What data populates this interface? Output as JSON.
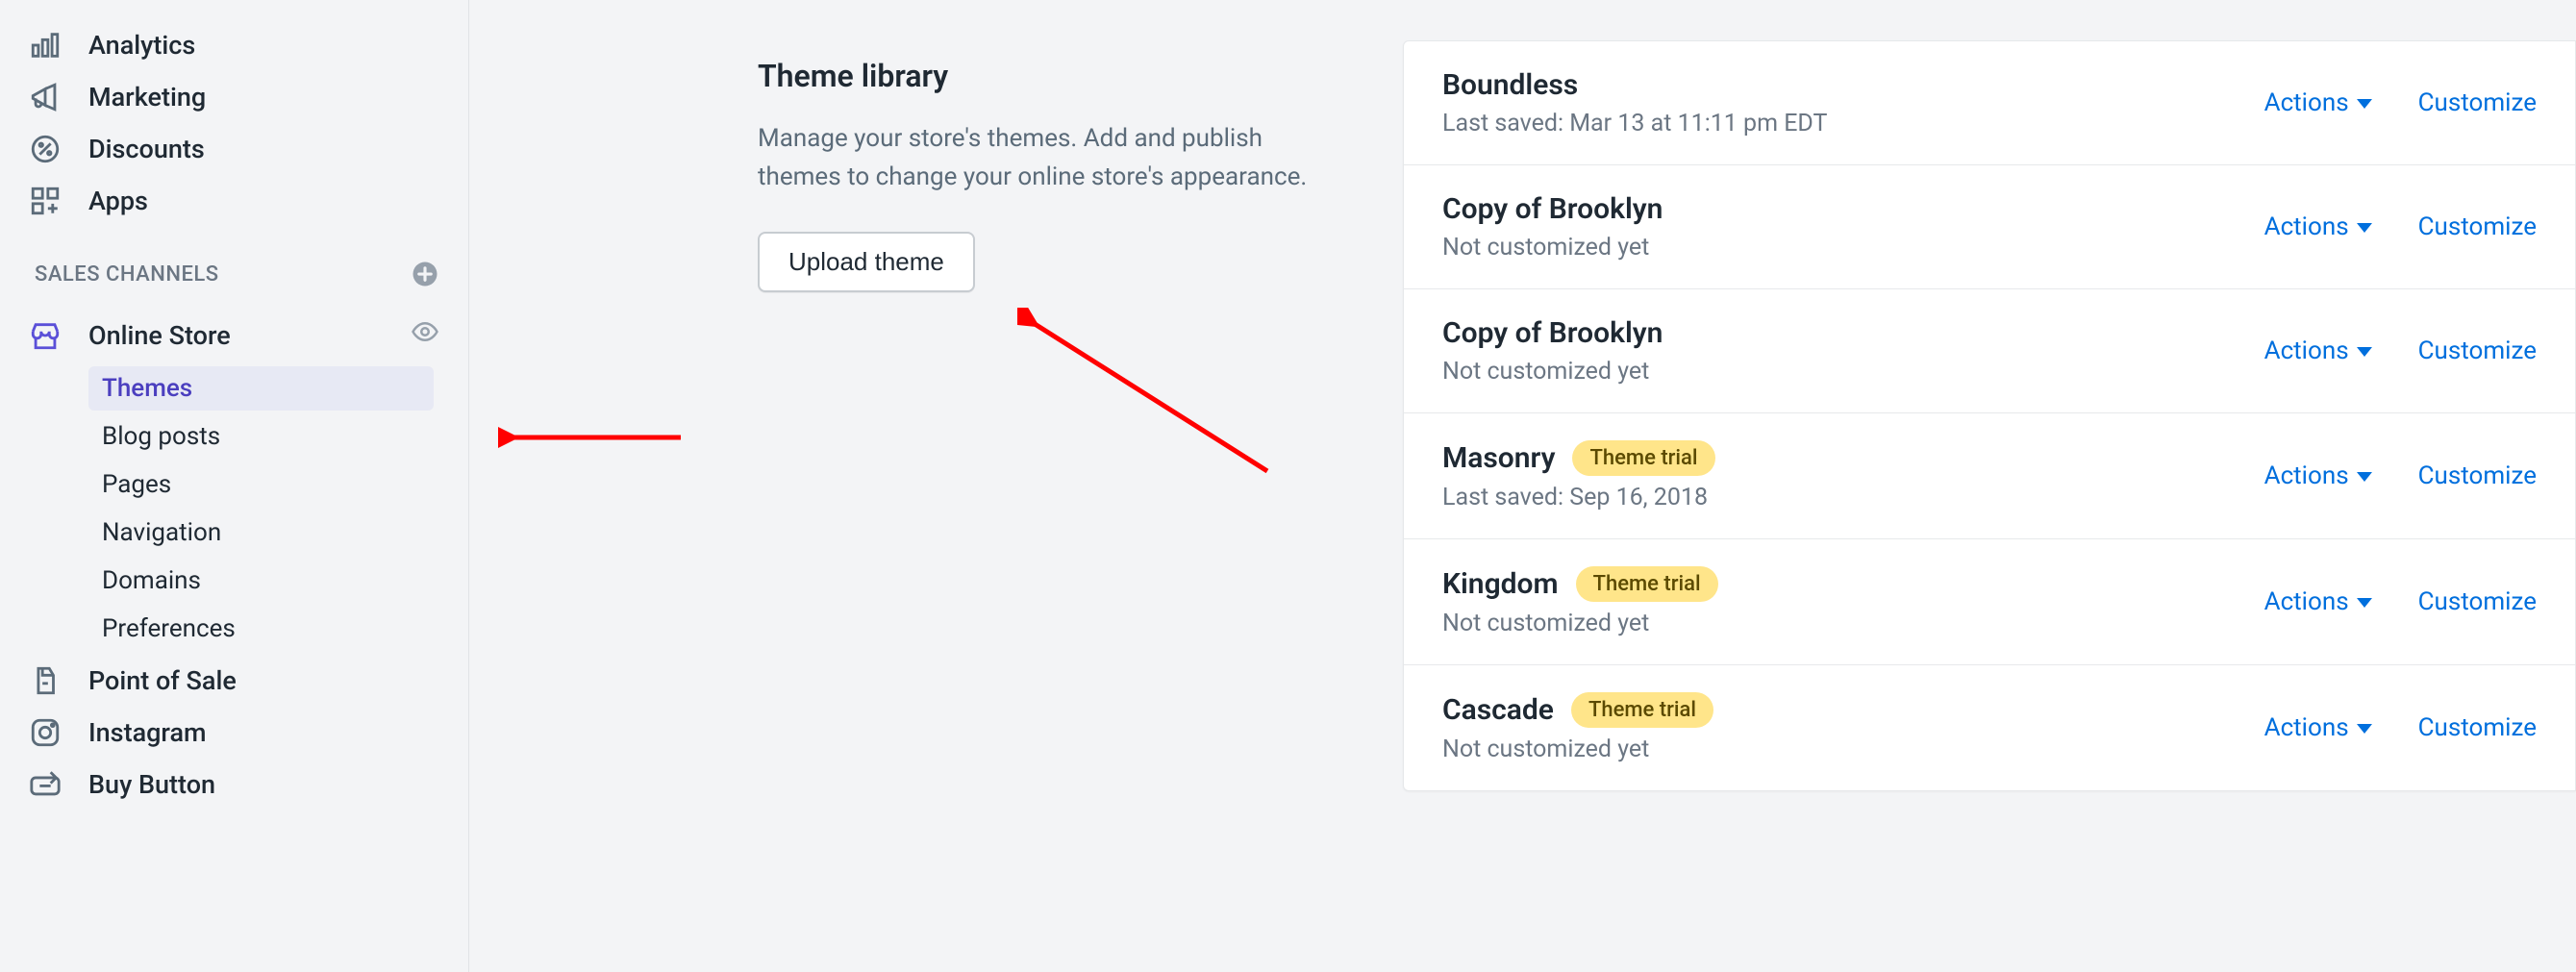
{
  "sidebar": {
    "nav": [
      {
        "label": "Analytics",
        "icon": "analytics-icon"
      },
      {
        "label": "Marketing",
        "icon": "megaphone-icon"
      },
      {
        "label": "Discounts",
        "icon": "discount-icon"
      },
      {
        "label": "Apps",
        "icon": "apps-icon"
      }
    ],
    "section_label": "SALES CHANNELS",
    "channels": [
      {
        "label": "Online Store",
        "icon": "store-icon",
        "eye": true,
        "sub": [
          {
            "label": "Themes",
            "active": true
          },
          {
            "label": "Blog posts"
          },
          {
            "label": "Pages"
          },
          {
            "label": "Navigation"
          },
          {
            "label": "Domains"
          },
          {
            "label": "Preferences"
          }
        ]
      },
      {
        "label": "Point of Sale",
        "icon": "pos-icon"
      },
      {
        "label": "Instagram",
        "icon": "instagram-icon"
      },
      {
        "label": "Buy Button",
        "icon": "buy-button-icon"
      }
    ]
  },
  "library": {
    "title": "Theme library",
    "description": "Manage your store's themes. Add and publish themes to change your online store's appearance.",
    "upload_label": "Upload theme"
  },
  "actions": {
    "actions_label": "Actions",
    "customize_label": "Customize"
  },
  "themes": [
    {
      "name": "Boundless",
      "subtitle": "Last saved: Mar 13 at 11:11 pm EDT",
      "badge": null
    },
    {
      "name": "Copy of Brooklyn",
      "subtitle": "Not customized yet",
      "badge": null
    },
    {
      "name": "Copy of Brooklyn",
      "subtitle": "Not customized yet",
      "badge": null
    },
    {
      "name": "Masonry",
      "subtitle": "Last saved: Sep 16, 2018",
      "badge": "Theme trial"
    },
    {
      "name": "Kingdom",
      "subtitle": "Not customized yet",
      "badge": "Theme trial"
    },
    {
      "name": "Cascade",
      "subtitle": "Not customized yet",
      "badge": "Theme trial"
    }
  ]
}
